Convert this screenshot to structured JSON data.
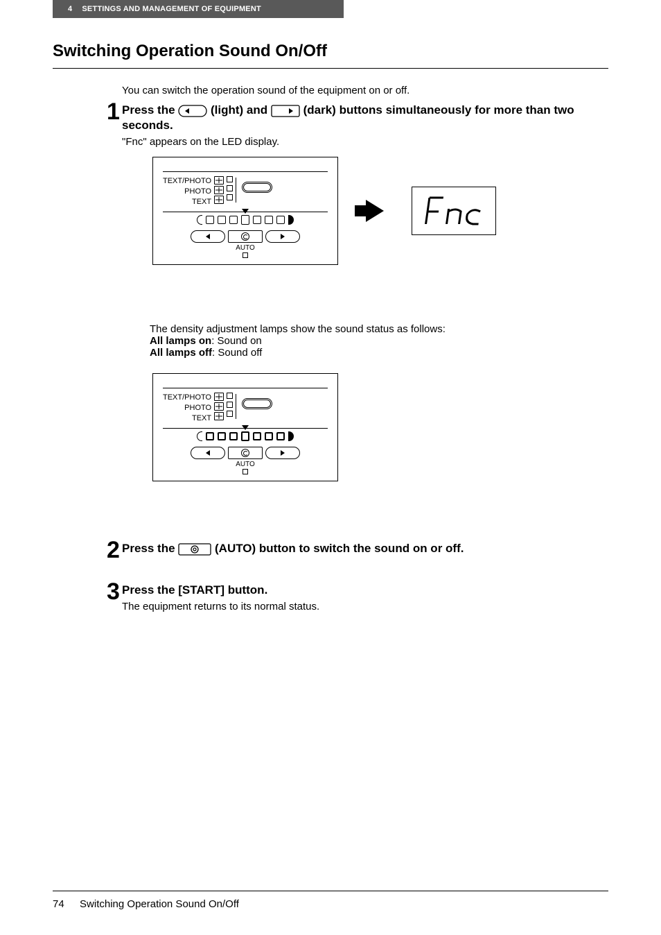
{
  "header": {
    "chapter_number": "4",
    "chapter_title": "SETTINGS AND MANAGEMENT OF EQUIPMENT"
  },
  "page_title": "Switching Operation Sound On/Off",
  "intro": "You can switch the operation sound of the equipment on or off.",
  "steps": {
    "s1": {
      "num": "1",
      "text_a": "Press the ",
      "light_label": " (light) and ",
      "dark_label": " (dark) buttons simultaneously for more than two seconds.",
      "sub": "\"Fnc\" appears on the LED display.",
      "led_text": "Fnc",
      "status_intro": "The density adjustment lamps show the sound status as follows:",
      "all_on_label": "All lamps on",
      "all_on_text": ": Sound on",
      "all_off_label": "All lamps off",
      "all_off_text": ": Sound off"
    },
    "s2": {
      "num": "2",
      "text_a": "Press the ",
      "text_b": " (AUTO) button to switch the sound on or off."
    },
    "s3": {
      "num": "3",
      "title": "Press the [START] button.",
      "sub": "The equipment returns to its normal status."
    }
  },
  "panel": {
    "mode1": "TEXT/PHOTO",
    "mode2": "PHOTO",
    "mode3": "TEXT",
    "auto": "AUTO"
  },
  "footer": {
    "page": "74",
    "title": "Switching Operation Sound On/Off"
  }
}
